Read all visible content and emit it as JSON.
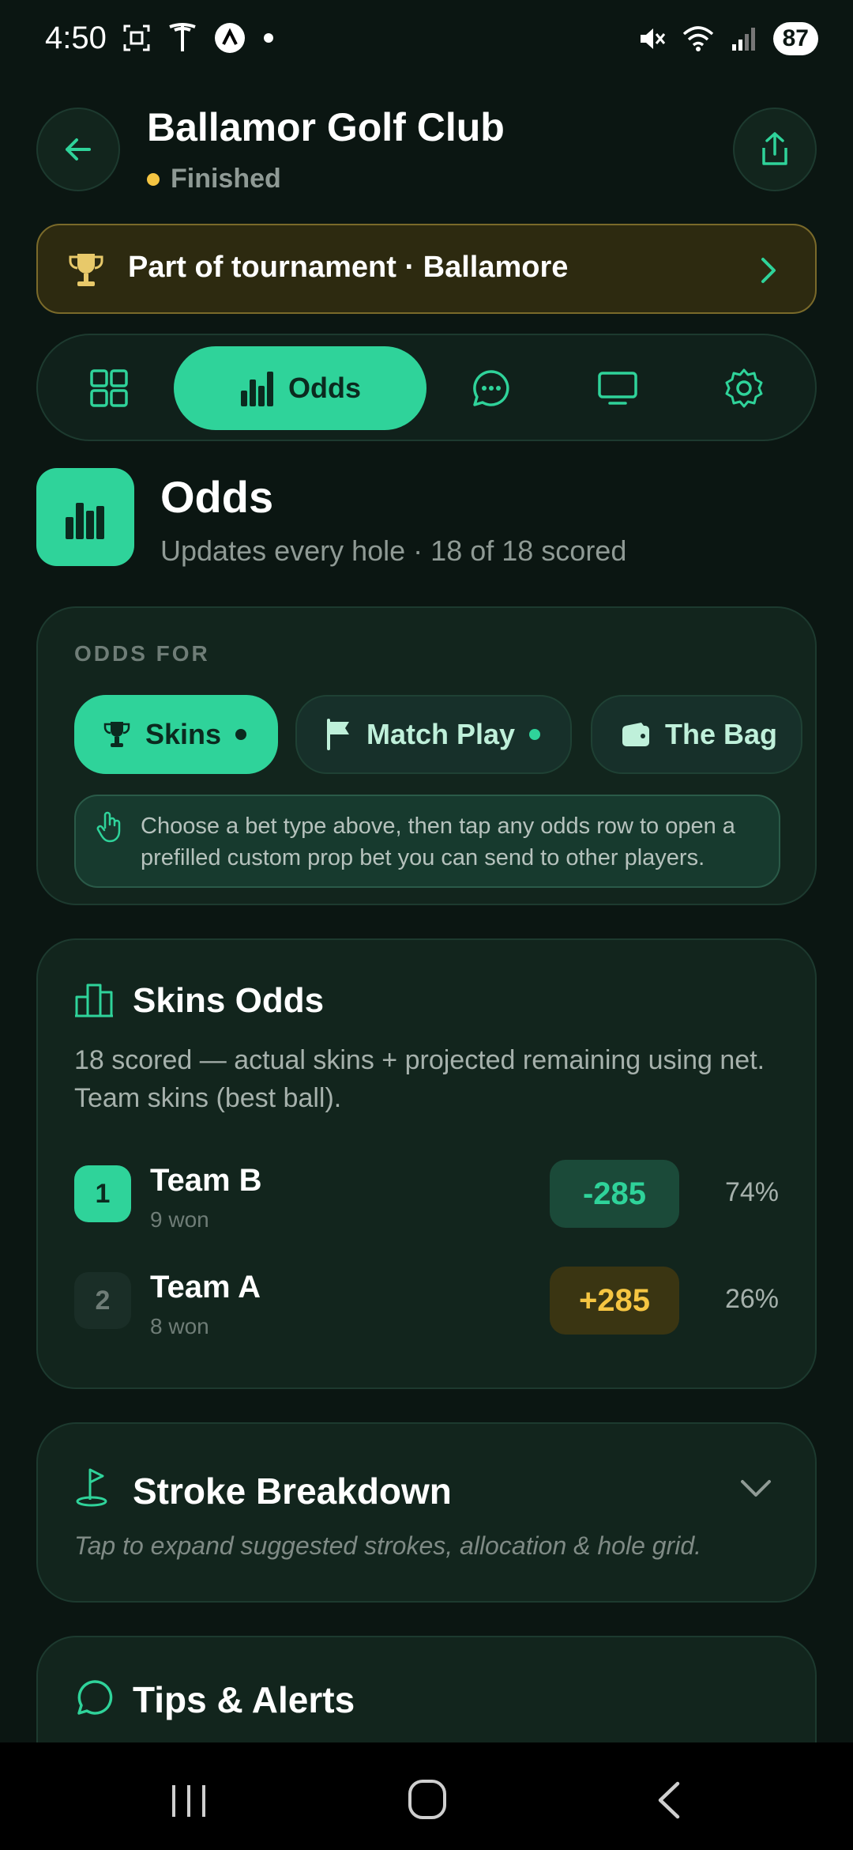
{
  "status_bar": {
    "time": "4:50",
    "battery": "87"
  },
  "header": {
    "title": "Ballamor Golf Club",
    "status": "Finished",
    "status_color": "#f5c542"
  },
  "banner": {
    "text": "Part of tournament · Ballamore"
  },
  "tabs": {
    "active_label": "Odds",
    "icons": [
      "grid-icon",
      "bar-chart-icon",
      "chat-icon",
      "tv-icon",
      "gear-icon"
    ]
  },
  "section": {
    "title": "Odds",
    "subtitle": "Updates every hole · 18 of 18 scored"
  },
  "odds_for": {
    "label": "ODDS FOR",
    "pills": [
      "Skins",
      "Match Play",
      "The Bag"
    ],
    "hint": "Choose a bet type above, then tap any odds row to open a prefilled custom prop bet you can send to other players."
  },
  "skins_odds": {
    "title": "Skins Odds",
    "description": "18 scored — actual skins + projected remaining using net. Team skins (best ball).",
    "rows": [
      {
        "rank": "1",
        "team": "Team B",
        "won": "9 won",
        "odds": "-285",
        "pct": "74%"
      },
      {
        "rank": "2",
        "team": "Team A",
        "won": "8 won",
        "odds": "+285",
        "pct": "26%"
      }
    ]
  },
  "stroke_breakdown": {
    "title": "Stroke Breakdown",
    "subtitle": "Tap to expand suggested strokes, allocation & hole grid."
  },
  "tips": {
    "title": "Tips & Alerts"
  },
  "colors": {
    "accent": "#2fd39a",
    "background": "#0b1612",
    "card": "#12251d",
    "gold": "#f5c542"
  }
}
